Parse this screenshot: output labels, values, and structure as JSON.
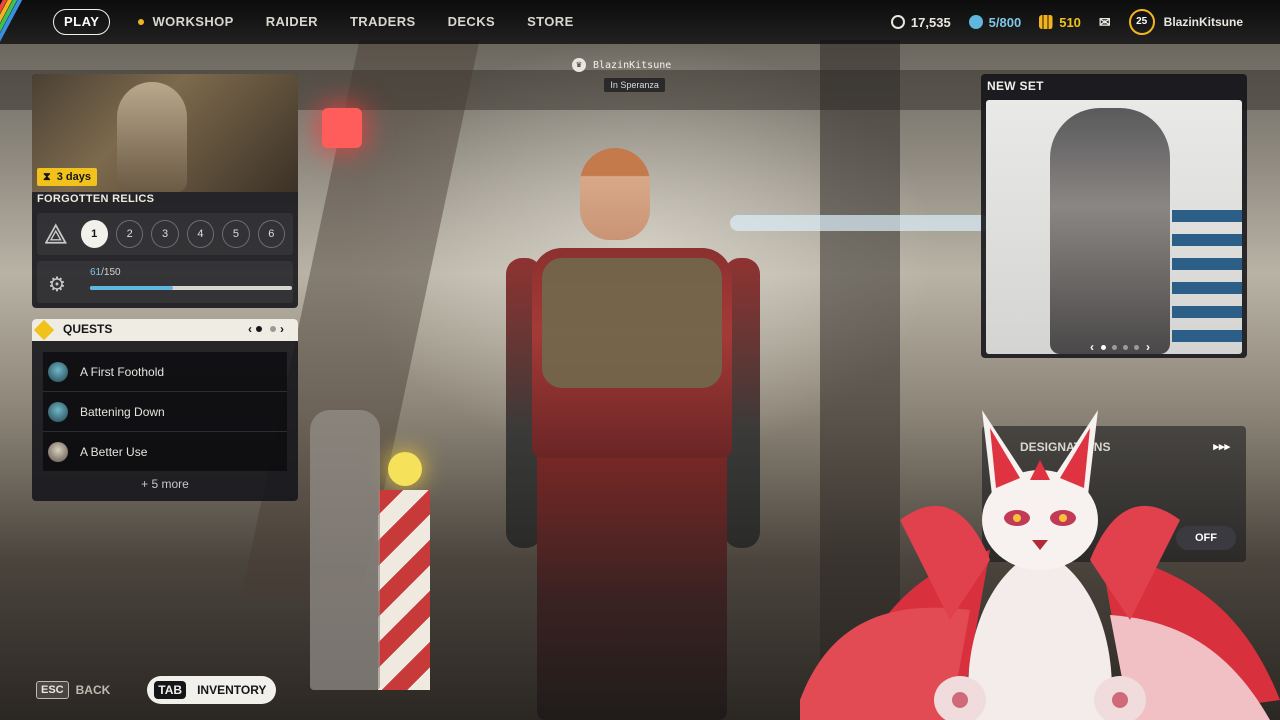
{
  "topbar": {
    "play_label": "PLAY",
    "nav": [
      "WORKSHOP",
      "RAIDER",
      "TRADERS",
      "DECKS",
      "STORE"
    ],
    "currency_credits": "17,535",
    "currency_storage": "5/800",
    "currency_coins": "510",
    "level": "25",
    "username": "BlazinKitsune",
    "icons": [
      "credits-icon",
      "storage-icon",
      "coins-icon",
      "mail-icon"
    ]
  },
  "player_tag": {
    "name": "BlazinKitsune",
    "location": "In Speranza"
  },
  "event": {
    "timer_value": "3",
    "timer_unit": "days",
    "title": "FORGOTTEN RELICS",
    "tiers": [
      "1",
      "2",
      "3",
      "4",
      "5",
      "6"
    ],
    "active_tier": "1",
    "progress_current": "61",
    "progress_total": "/150",
    "progress_fraction": 0.41
  },
  "quests": {
    "header": "QUESTS",
    "items": [
      "A First Foothold",
      "Battening Down",
      "A Better Use"
    ],
    "more": "+ 5 more"
  },
  "new_set": {
    "label": "NEW SET"
  },
  "designations": {
    "label": "DESIGNATIONS",
    "arrows": "▸▸▸",
    "toggle": "OFF"
  },
  "bottom": {
    "esc_key": "ESC",
    "back_label": "BACK",
    "tab_key": "TAB",
    "inventory_label": "INVENTORY"
  },
  "colors": {
    "accent_yellow": "#f2c21c",
    "progress_blue": "#5fb7de",
    "panel_dark": "#14151a"
  }
}
